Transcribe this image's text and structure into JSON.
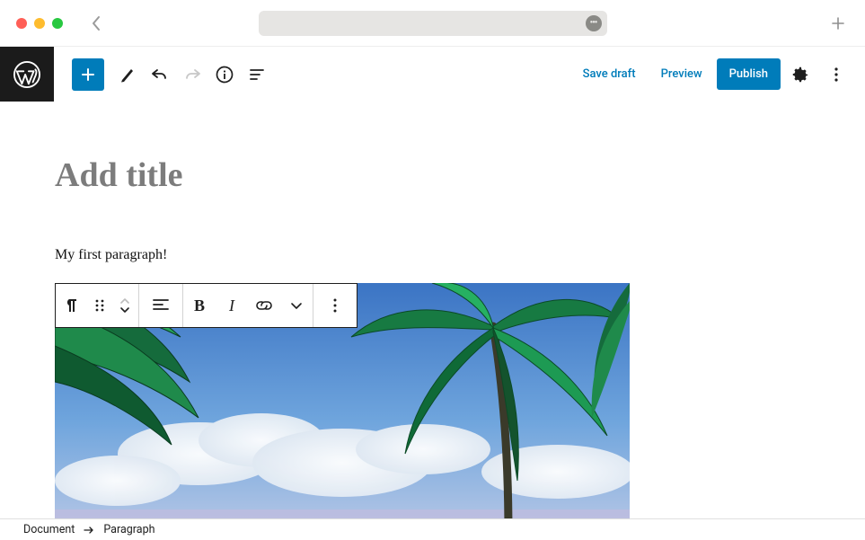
{
  "toolbar": {
    "save_draft": "Save draft",
    "preview": "Preview",
    "publish": "Publish"
  },
  "editor": {
    "title_placeholder": "Add title",
    "paragraph_text": "My first paragraph!"
  },
  "block_toolbar": {
    "bold_label": "B",
    "italic_label": "I"
  },
  "breadcrumb": {
    "root": "Document",
    "current": "Paragraph"
  }
}
